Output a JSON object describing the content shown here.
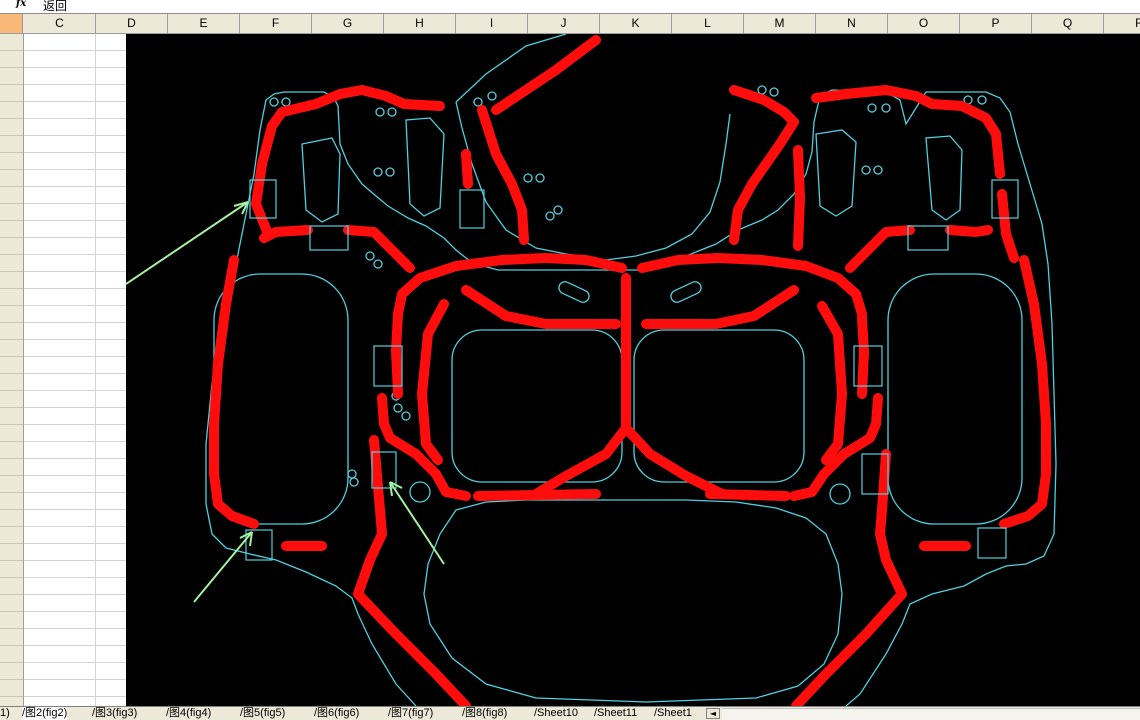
{
  "formula_bar": {
    "fx_label": "fx",
    "cell_text": "返回"
  },
  "columns": [
    "C",
    "D",
    "E",
    "F",
    "G",
    "H",
    "I",
    "J",
    "K",
    "L",
    "M",
    "N",
    "O",
    "P",
    "Q",
    "R"
  ],
  "sheet_tabs": [
    {
      "label": "1)",
      "active": false
    },
    {
      "label": "图2(fig2)",
      "active": true
    },
    {
      "label": "图3(fig3)",
      "active": false
    },
    {
      "label": "图4(fig4)",
      "active": false
    },
    {
      "label": "图5(fig5)",
      "active": false
    },
    {
      "label": "图6(fig6)",
      "active": false
    },
    {
      "label": "图7(fig7)",
      "active": false
    },
    {
      "label": "图8(fig8)",
      "active": false
    },
    {
      "label": "Sheet10",
      "active": false
    },
    {
      "label": "Sheet11",
      "active": false
    },
    {
      "label": "Sheet1",
      "active": false
    }
  ],
  "tab_separator": "/",
  "scroll_glyph": "◄",
  "colors": {
    "drawing_background": "#000000",
    "outline": "#4fd0e0",
    "fixture_rail": "#ff0d0d",
    "annotation_arrow": "#a6f0a0"
  }
}
